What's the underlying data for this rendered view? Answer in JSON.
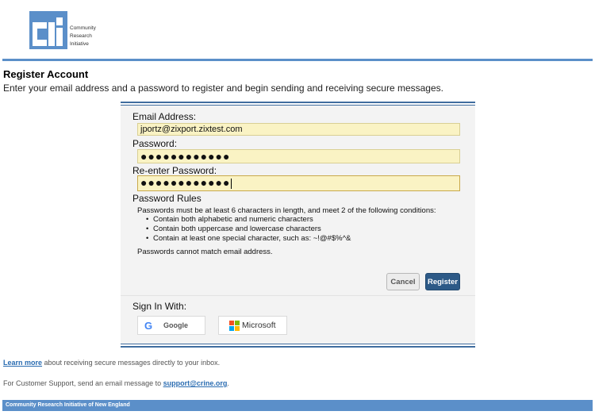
{
  "logo": {
    "mark_text": "cri",
    "lines": [
      "Community",
      "Research",
      "Initiative"
    ]
  },
  "page": {
    "title": "Register Account",
    "intro": "Enter your email address and a password to register and begin sending and receiving secure messages."
  },
  "form": {
    "email_label": "Email Address:",
    "email_value": "jportz@zixport.zixtest.com",
    "password_label": "Password:",
    "password_value": "●●●●●●●●●●●●",
    "reenter_label": "Re-enter Password:",
    "reenter_value": "●●●●●●●●●●●●"
  },
  "rules": {
    "title": "Password Rules",
    "intro": "Passwords must be at least 6 characters in length, and meet 2 of the following conditions:",
    "items": [
      "Contain both alphabetic and numeric characters",
      "Contain both uppercase and lowercase characters",
      "Contain at least one special character, such as: ~!@#$%^&"
    ],
    "note": "Passwords cannot match email address."
  },
  "buttons": {
    "cancel": "Cancel",
    "register": "Register"
  },
  "signin": {
    "label": "Sign In With:",
    "google": "Google",
    "microsoft": "Microsoft"
  },
  "links": {
    "learn_more": "Learn more",
    "learn_more_rest": " about receiving secure messages directly to your inbox.",
    "support_prefix": "For Customer Support, send an email message to ",
    "support_email": "support@crine.org",
    "support_suffix": "."
  },
  "footer": {
    "text": "Community Research Initiative of New England"
  },
  "colors": {
    "accent_blue": "#5b8fc9",
    "button_primary": "#2d5a87",
    "field_bg": "#faf3c4",
    "link": "#2a6cb1"
  }
}
